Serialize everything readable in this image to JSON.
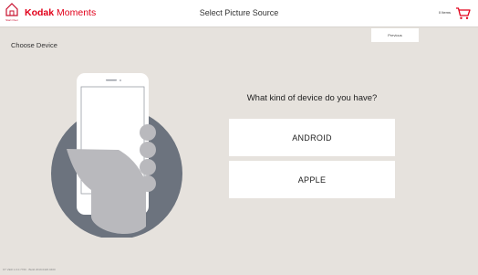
{
  "header": {
    "home_label": "Start Over",
    "brand_name": "Kodak",
    "brand_suffix": "Moments",
    "title": "Select Picture Source",
    "cart_count": "0 Items"
  },
  "nav": {
    "previous_label": "Previous"
  },
  "section_label": "Choose Device",
  "question": "What kind of device do you have?",
  "devices": [
    {
      "label": "ANDROID"
    },
    {
      "label": "APPLE"
    }
  ],
  "footer_text": "KT VER 1.0.0.7760 · Build 2019.0426.0400",
  "colors": {
    "brand": "#e2001a",
    "background": "#e6e2dd",
    "illustration_circle": "#6c737e"
  },
  "icons": {
    "home": "home-icon",
    "cart": "shopping-cart-icon"
  }
}
